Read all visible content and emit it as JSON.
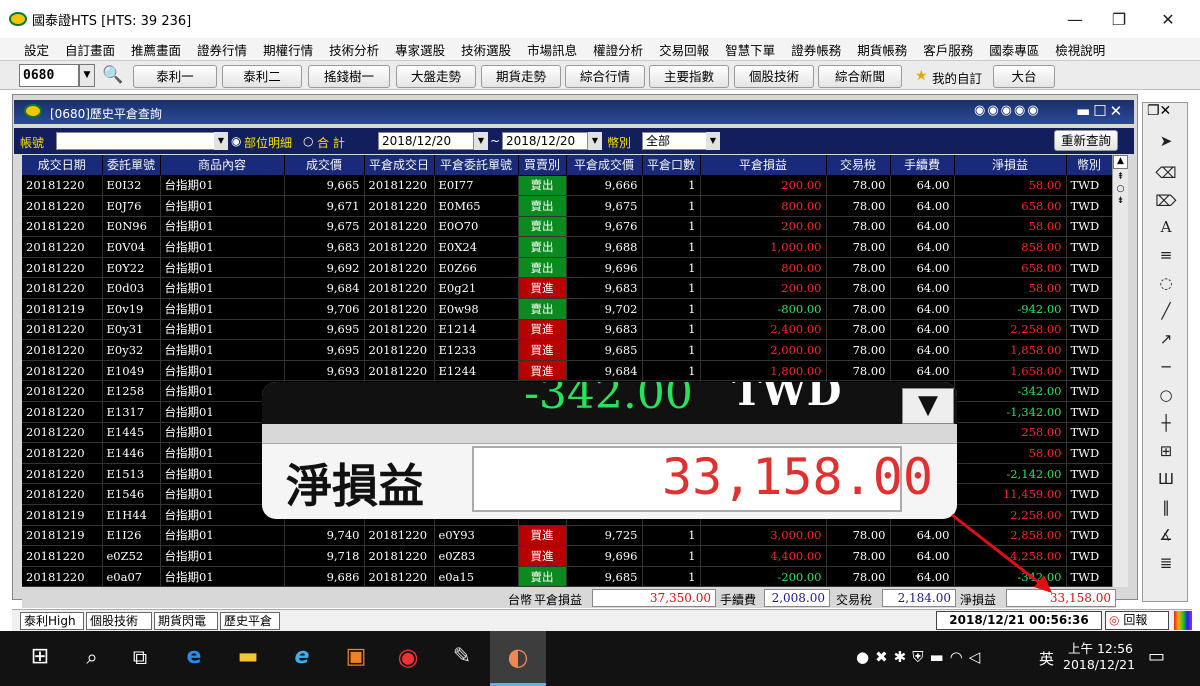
{
  "window": {
    "title": "國泰證HTS  [HTS: 39 236]"
  },
  "menu": [
    "設定",
    "自訂畫面",
    "推薦畫面",
    "證券行情",
    "期權行情",
    "技術分析",
    "專家選股",
    "技術選股",
    "市場訊息",
    "權證分析",
    "交易回報",
    "智慧下單",
    "證券帳務",
    "期貨帳務",
    "客戶服務",
    "國泰專區",
    "檢視說明"
  ],
  "toolbar": {
    "code": "0680",
    "buttons": [
      "泰利一",
      "泰利二",
      "搖錢樹一",
      "大盤走勢",
      "期貨走勢",
      "綜合行情",
      "主要指數",
      "個股技術",
      "綜合新聞"
    ],
    "favorite": "我的自訂",
    "market": "大台"
  },
  "panel": {
    "title": "[0680]歷史平倉查詢",
    "account_label": "帳號",
    "radio_detail": "部位明細",
    "radio_total": "合 計",
    "date_from": "2018/12/20",
    "date_to": "2018/12/20",
    "currency_label": "幣別",
    "currency_value": "全部",
    "refresh": "重新查詢"
  },
  "table": {
    "headers": [
      "成交日期",
      "委託單號",
      "商品內容",
      "成交價",
      "平倉成交日",
      "平倉委託單號",
      "買賣別",
      "平倉成交價",
      "平倉口數",
      "平倉損益",
      "交易稅",
      "手續費",
      "淨損益",
      "幣別"
    ],
    "rows": [
      [
        "20181220",
        "E0I32",
        "台指期01",
        "9,665",
        "20181220",
        "E0I77",
        "賣出",
        "9,666",
        "1",
        "200.00",
        "78.00",
        "64.00",
        "58.00",
        "TWD"
      ],
      [
        "20181220",
        "E0J76",
        "台指期01",
        "9,671",
        "20181220",
        "E0M65",
        "賣出",
        "9,675",
        "1",
        "800.00",
        "78.00",
        "64.00",
        "658.00",
        "TWD"
      ],
      [
        "20181220",
        "E0N96",
        "台指期01",
        "9,675",
        "20181220",
        "E0O70",
        "賣出",
        "9,676",
        "1",
        "200.00",
        "78.00",
        "64.00",
        "58.00",
        "TWD"
      ],
      [
        "20181220",
        "E0V04",
        "台指期01",
        "9,683",
        "20181220",
        "E0X24",
        "賣出",
        "9,688",
        "1",
        "1,000.00",
        "78.00",
        "64.00",
        "858.00",
        "TWD"
      ],
      [
        "20181220",
        "E0Y22",
        "台指期01",
        "9,692",
        "20181220",
        "E0Z66",
        "賣出",
        "9,696",
        "1",
        "800.00",
        "78.00",
        "64.00",
        "658.00",
        "TWD"
      ],
      [
        "20181220",
        "E0d03",
        "台指期01",
        "9,684",
        "20181220",
        "E0g21",
        "買進",
        "9,683",
        "1",
        "200.00",
        "78.00",
        "64.00",
        "58.00",
        "TWD"
      ],
      [
        "20181219",
        "E0v19",
        "台指期01",
        "9,706",
        "20181220",
        "E0w98",
        "賣出",
        "9,702",
        "1",
        "-800.00",
        "78.00",
        "64.00",
        "-942.00",
        "TWD"
      ],
      [
        "20181220",
        "E0y31",
        "台指期01",
        "9,695",
        "20181220",
        "E1214",
        "買進",
        "9,683",
        "1",
        "2,400.00",
        "78.00",
        "64.00",
        "2,258.00",
        "TWD"
      ],
      [
        "20181220",
        "E0y32",
        "台指期01",
        "9,695",
        "20181220",
        "E1233",
        "買進",
        "9,685",
        "1",
        "2,000.00",
        "78.00",
        "64.00",
        "1,858.00",
        "TWD"
      ],
      [
        "20181220",
        "E1049",
        "台指期01",
        "9,693",
        "20181220",
        "E1244",
        "買進",
        "9,684",
        "1",
        "1,800.00",
        "78.00",
        "64.00",
        "1,658.00",
        "TWD"
      ],
      [
        "20181220",
        "E1258",
        "台指期01",
        "",
        "",
        "",
        "",
        "",
        "",
        "",
        "",
        "",
        "-342.00",
        "TWD"
      ],
      [
        "20181220",
        "E1317",
        "台指期01",
        "",
        "",
        "",
        "",
        "",
        "",
        "",
        "",
        "",
        "-1,342.00",
        "TWD"
      ],
      [
        "20181220",
        "E1445",
        "台指期01",
        "",
        "",
        "",
        "",
        "",
        "",
        "",
        "",
        "",
        "258.00",
        "TWD"
      ],
      [
        "20181220",
        "E1446",
        "台指期01",
        "",
        "",
        "",
        "",
        "",
        "",
        "",
        "",
        "",
        "58.00",
        "TWD"
      ],
      [
        "20181220",
        "E1513",
        "台指期01",
        "",
        "",
        "",
        "",
        "",
        "",
        "",
        "",
        "",
        "-2,142.00",
        "TWD"
      ],
      [
        "20181220",
        "E1546",
        "台指期01",
        "",
        "",
        "",
        "",
        "",
        "",
        "",
        "",
        "",
        "11,459.00",
        "TWD"
      ],
      [
        "20181219",
        "E1H44",
        "台指期01",
        "",
        "",
        "",
        "",
        "",
        "",
        "",
        "",
        "",
        "2,258.00",
        "TWD"
      ],
      [
        "20181219",
        "E1I26",
        "台指期01",
        "9,740",
        "20181220",
        "e0Y93",
        "買進",
        "9,725",
        "1",
        "3,000.00",
        "78.00",
        "64.00",
        "2,858.00",
        "TWD"
      ],
      [
        "20181220",
        "e0Z52",
        "台指期01",
        "9,718",
        "20181220",
        "e0Z83",
        "買進",
        "9,696",
        "1",
        "4,400.00",
        "78.00",
        "64.00",
        "4,258.00",
        "TWD"
      ],
      [
        "20181220",
        "e0a07",
        "台指期01",
        "9,686",
        "20181220",
        "e0a15",
        "賣出",
        "9,685",
        "1",
        "-200.00",
        "78.00",
        "64.00",
        "-342.00",
        "TWD"
      ]
    ]
  },
  "summary": {
    "currency": "台幣",
    "pl_label": "平倉損益",
    "pl": "37,350.00",
    "fee_label": "手續費",
    "fee": "2,008.00",
    "tax_label": "交易稅",
    "tax": "2,184.00",
    "net_label": "淨損益",
    "net": "33,158.00"
  },
  "tabs": [
    "泰利High一",
    "個股技術",
    "期貨閃電",
    "歷史平倉"
  ],
  "status": {
    "datetime": "2018/12/21 00:56:36",
    "report": "回報"
  },
  "zoom": {
    "top_value": "-342.00",
    "top_currency": "TWD",
    "label": "淨損益",
    "value": "33,158.00"
  },
  "taskbar": {
    "time": "上午 12:56",
    "date": "2018/12/21",
    "ime": "英"
  },
  "colors": {
    "profit": "#ff2020",
    "loss": "#27e25b",
    "header": "#1a2a7a"
  }
}
